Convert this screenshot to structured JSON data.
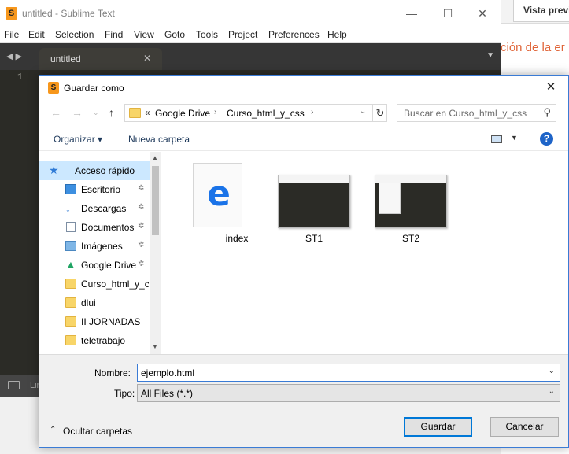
{
  "background_browser": {
    "preview_tab": "Vista previa",
    "orange_text": "ción de la er"
  },
  "sublime": {
    "title": "untitled - Sublime Text",
    "logo": "S",
    "menu": [
      "File",
      "Edit",
      "Selection",
      "Find",
      "View",
      "Goto",
      "Tools",
      "Project",
      "Preferences",
      "Help"
    ],
    "tab_label": "untitled",
    "line_number": "1",
    "status_text": "Lin"
  },
  "dialog": {
    "logo": "S",
    "title": "Guardar como",
    "address": {
      "prefix": "«",
      "crumbs": [
        "Google Drive",
        "Curso_html_y_css"
      ]
    },
    "search_placeholder": "Buscar en Curso_html_y_css",
    "toolbar": {
      "organize": "Organizar ▾",
      "new_folder": "Nueva carpeta",
      "help": "?"
    },
    "nav": [
      {
        "label": "Acceso rápido",
        "icon": "star-icon",
        "pinned": false,
        "selected": true
      },
      {
        "label": "Escritorio",
        "icon": "desktop-icon",
        "pinned": true
      },
      {
        "label": "Descargas",
        "icon": "download-arrow-icon",
        "pinned": true
      },
      {
        "label": "Documentos",
        "icon": "document-icon",
        "pinned": true
      },
      {
        "label": "Imágenes",
        "icon": "pictures-icon",
        "pinned": true
      },
      {
        "label": "Google Drive",
        "icon": "google-drive-icon",
        "pinned": true
      },
      {
        "label": "Curso_html_y_css",
        "icon": "folder-icon",
        "pinned": false
      },
      {
        "label": "dlui",
        "icon": "folder-icon",
        "pinned": false
      },
      {
        "label": "II JORNADAS",
        "icon": "folder-icon",
        "pinned": false
      },
      {
        "label": "teletrabajo",
        "icon": "folder-icon",
        "pinned": false
      }
    ],
    "files": [
      {
        "name": "index",
        "kind": "edge-html-document"
      },
      {
        "name": "ST1",
        "kind": "screenshot-thumbnail"
      },
      {
        "name": "ST2",
        "kind": "screenshot-thumbnail"
      }
    ],
    "name_label": "Nombre:",
    "name_value": "ejemplo.html",
    "type_label": "Tipo:",
    "type_value": "All Files (*.*)",
    "hide_folders": "Ocultar carpetas",
    "save_button": "Guardar",
    "cancel_button": "Cancelar"
  },
  "colors": {
    "accent": "#0078d7",
    "sublime_bg": "#2b2b26",
    "sublime_logo": "#f7971c",
    "selected_nav": "#cce8ff",
    "orange_text": "#e0663a"
  }
}
